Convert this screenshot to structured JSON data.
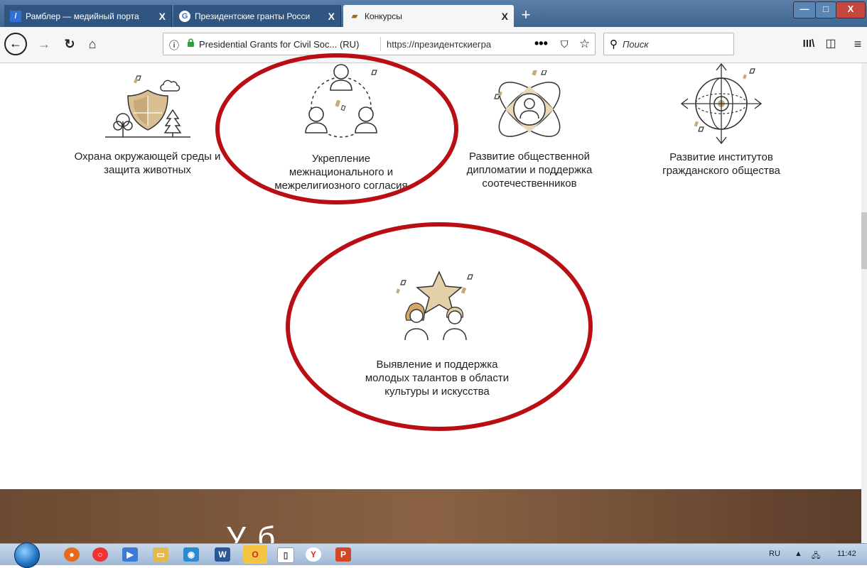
{
  "tabs": [
    {
      "title": "Рамблер — медийный порта",
      "favicon": "/"
    },
    {
      "title": "Президентские гранты Росси",
      "favicon": "G"
    },
    {
      "title": "Конкурсы",
      "favicon": "▰"
    }
  ],
  "tab_close": "X",
  "window_controls": {
    "minimize": "—",
    "maximize": "□",
    "close": "X"
  },
  "nav": {
    "site_identity": "Presidential Grants for Civil Soc... (RU)",
    "url": "https://президентскиегра",
    "page_actions": "•••",
    "search_placeholder": "Поиск"
  },
  "cards": [
    {
      "label": "Охрана окружающей среды и защита животных",
      "icon": "shield-tree-icon"
    },
    {
      "label": "Укрепление межнационального и межрелигиозного согласия",
      "icon": "people-circle-icon"
    },
    {
      "label": "Развитие общественной дипломатии и поддержка соотечественников",
      "icon": "person-orbit-icon"
    },
    {
      "label": "Развитие институтов гражданского общества",
      "icon": "globe-compass-icon"
    },
    {
      "label": "Выявление и поддержка молодых талантов в области культуры и искусства",
      "icon": "star-youth-icon"
    }
  ],
  "band_text": "У     б",
  "taskbar": {
    "lang": "RU",
    "time": "11:42"
  },
  "colors": {
    "highlight": "#b90f14",
    "accent": "#c8a97a"
  }
}
